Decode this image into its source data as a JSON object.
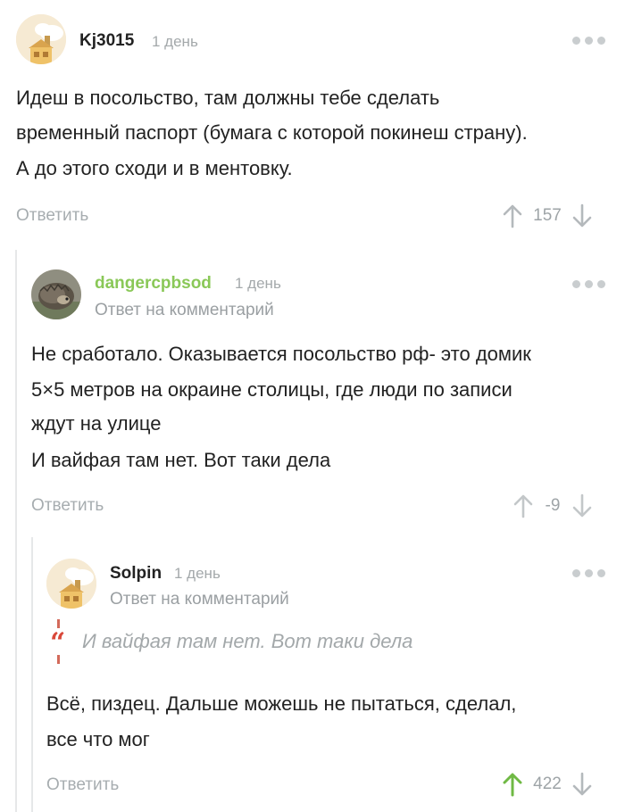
{
  "comments": [
    {
      "username": "Kj3015",
      "date": "1 день",
      "lines": [
        "Идеш в посольство, там должны тебе сделать",
        "временный паспорт (бумага с которой покинеш страну).",
        "А до этого сходи и в ментовку."
      ],
      "reply_label": "Ответить",
      "score": "157",
      "avatar_icon": "default-house-avatar-icon"
    },
    {
      "username": "dangercpbsod",
      "date": "1 день",
      "reply_to_prefix": "Ответ на",
      "reply_to_link": "комментарий",
      "lines": [
        "Не сработало. Оказывается посольство рф- это домик",
        "5×5 метров на окраине столицы, где люди по записи",
        "ждут на улице",
        "И вайфая там нет. Вот таки дела"
      ],
      "reply_label": "Ответить",
      "score": "-9",
      "avatar_icon": "hedgehog-photo-avatar-icon"
    },
    {
      "username": "Solpin",
      "date": "1 день",
      "reply_to_prefix": "Ответ на",
      "reply_to_link": "комментарий",
      "quote": "И вайфая там нет. Вот таки дела",
      "lines": [
        "Всё, пиздец. Дальше можешь не пытаться, сделал,",
        "все что мог"
      ],
      "reply_label": "Ответить",
      "score": "422",
      "avatar_icon": "default-house-avatar-icon"
    }
  ],
  "colors": {
    "username_green": "#8ac858",
    "upvote_active": "#6fb944",
    "quote_accent": "#d9483a",
    "muted": "#a7adb0"
  }
}
